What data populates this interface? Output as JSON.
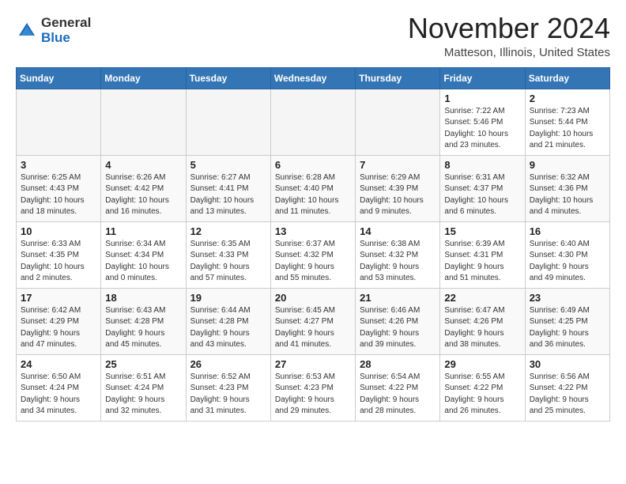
{
  "logo": {
    "general": "General",
    "blue": "Blue"
  },
  "header": {
    "month_year": "November 2024",
    "location": "Matteson, Illinois, United States"
  },
  "weekdays": [
    "Sunday",
    "Monday",
    "Tuesday",
    "Wednesday",
    "Thursday",
    "Friday",
    "Saturday"
  ],
  "weeks": [
    [
      {
        "day": "",
        "info": ""
      },
      {
        "day": "",
        "info": ""
      },
      {
        "day": "",
        "info": ""
      },
      {
        "day": "",
        "info": ""
      },
      {
        "day": "",
        "info": ""
      },
      {
        "day": "1",
        "info": "Sunrise: 7:22 AM\nSunset: 5:46 PM\nDaylight: 10 hours\nand 23 minutes."
      },
      {
        "day": "2",
        "info": "Sunrise: 7:23 AM\nSunset: 5:44 PM\nDaylight: 10 hours\nand 21 minutes."
      }
    ],
    [
      {
        "day": "3",
        "info": "Sunrise: 6:25 AM\nSunset: 4:43 PM\nDaylight: 10 hours\nand 18 minutes."
      },
      {
        "day": "4",
        "info": "Sunrise: 6:26 AM\nSunset: 4:42 PM\nDaylight: 10 hours\nand 16 minutes."
      },
      {
        "day": "5",
        "info": "Sunrise: 6:27 AM\nSunset: 4:41 PM\nDaylight: 10 hours\nand 13 minutes."
      },
      {
        "day": "6",
        "info": "Sunrise: 6:28 AM\nSunset: 4:40 PM\nDaylight: 10 hours\nand 11 minutes."
      },
      {
        "day": "7",
        "info": "Sunrise: 6:29 AM\nSunset: 4:39 PM\nDaylight: 10 hours\nand 9 minutes."
      },
      {
        "day": "8",
        "info": "Sunrise: 6:31 AM\nSunset: 4:37 PM\nDaylight: 10 hours\nand 6 minutes."
      },
      {
        "day": "9",
        "info": "Sunrise: 6:32 AM\nSunset: 4:36 PM\nDaylight: 10 hours\nand 4 minutes."
      }
    ],
    [
      {
        "day": "10",
        "info": "Sunrise: 6:33 AM\nSunset: 4:35 PM\nDaylight: 10 hours\nand 2 minutes."
      },
      {
        "day": "11",
        "info": "Sunrise: 6:34 AM\nSunset: 4:34 PM\nDaylight: 10 hours\nand 0 minutes."
      },
      {
        "day": "12",
        "info": "Sunrise: 6:35 AM\nSunset: 4:33 PM\nDaylight: 9 hours\nand 57 minutes."
      },
      {
        "day": "13",
        "info": "Sunrise: 6:37 AM\nSunset: 4:32 PM\nDaylight: 9 hours\nand 55 minutes."
      },
      {
        "day": "14",
        "info": "Sunrise: 6:38 AM\nSunset: 4:32 PM\nDaylight: 9 hours\nand 53 minutes."
      },
      {
        "day": "15",
        "info": "Sunrise: 6:39 AM\nSunset: 4:31 PM\nDaylight: 9 hours\nand 51 minutes."
      },
      {
        "day": "16",
        "info": "Sunrise: 6:40 AM\nSunset: 4:30 PM\nDaylight: 9 hours\nand 49 minutes."
      }
    ],
    [
      {
        "day": "17",
        "info": "Sunrise: 6:42 AM\nSunset: 4:29 PM\nDaylight: 9 hours\nand 47 minutes."
      },
      {
        "day": "18",
        "info": "Sunrise: 6:43 AM\nSunset: 4:28 PM\nDaylight: 9 hours\nand 45 minutes."
      },
      {
        "day": "19",
        "info": "Sunrise: 6:44 AM\nSunset: 4:28 PM\nDaylight: 9 hours\nand 43 minutes."
      },
      {
        "day": "20",
        "info": "Sunrise: 6:45 AM\nSunset: 4:27 PM\nDaylight: 9 hours\nand 41 minutes."
      },
      {
        "day": "21",
        "info": "Sunrise: 6:46 AM\nSunset: 4:26 PM\nDaylight: 9 hours\nand 39 minutes."
      },
      {
        "day": "22",
        "info": "Sunrise: 6:47 AM\nSunset: 4:26 PM\nDaylight: 9 hours\nand 38 minutes."
      },
      {
        "day": "23",
        "info": "Sunrise: 6:49 AM\nSunset: 4:25 PM\nDaylight: 9 hours\nand 36 minutes."
      }
    ],
    [
      {
        "day": "24",
        "info": "Sunrise: 6:50 AM\nSunset: 4:24 PM\nDaylight: 9 hours\nand 34 minutes."
      },
      {
        "day": "25",
        "info": "Sunrise: 6:51 AM\nSunset: 4:24 PM\nDaylight: 9 hours\nand 32 minutes."
      },
      {
        "day": "26",
        "info": "Sunrise: 6:52 AM\nSunset: 4:23 PM\nDaylight: 9 hours\nand 31 minutes."
      },
      {
        "day": "27",
        "info": "Sunrise: 6:53 AM\nSunset: 4:23 PM\nDaylight: 9 hours\nand 29 minutes."
      },
      {
        "day": "28",
        "info": "Sunrise: 6:54 AM\nSunset: 4:22 PM\nDaylight: 9 hours\nand 28 minutes."
      },
      {
        "day": "29",
        "info": "Sunrise: 6:55 AM\nSunset: 4:22 PM\nDaylight: 9 hours\nand 26 minutes."
      },
      {
        "day": "30",
        "info": "Sunrise: 6:56 AM\nSunset: 4:22 PM\nDaylight: 9 hours\nand 25 minutes."
      }
    ]
  ]
}
